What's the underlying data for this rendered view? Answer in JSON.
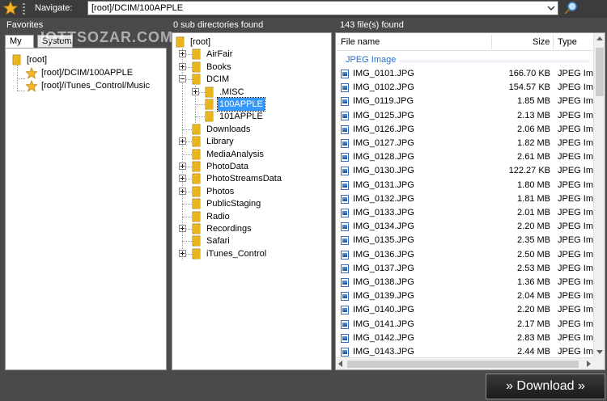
{
  "toolbar": {
    "navigate_label": "Navigate:",
    "path_value": "[root]/DCIM/100APPLE",
    "download_label": "» Download »"
  },
  "favorites": {
    "heading": "Favorites",
    "tabs": [
      "My",
      "System"
    ],
    "root_label": "[root]",
    "items": [
      "[root]/DCIM/100APPLE",
      "[root]/iTunes_Control/Music"
    ]
  },
  "directories": {
    "heading": "0 sub directories found",
    "root_label": "[root]",
    "items": [
      {
        "label": "AirFair",
        "level": 1,
        "expander": "plus"
      },
      {
        "label": "Books",
        "level": 1,
        "expander": "plus"
      },
      {
        "label": "DCIM",
        "level": 1,
        "expander": "minus"
      },
      {
        "label": ".MISC",
        "level": 2,
        "expander": "plus"
      },
      {
        "label": "100APPLE",
        "level": 2,
        "expander": "",
        "selected": true
      },
      {
        "label": "101APPLE",
        "level": 2,
        "expander": ""
      },
      {
        "label": "Downloads",
        "level": 1,
        "expander": ""
      },
      {
        "label": "Library",
        "level": 1,
        "expander": "plus"
      },
      {
        "label": "MediaAnalysis",
        "level": 1,
        "expander": ""
      },
      {
        "label": "PhotoData",
        "level": 1,
        "expander": "plus"
      },
      {
        "label": "PhotoStreamsData",
        "level": 1,
        "expander": "plus"
      },
      {
        "label": "Photos",
        "level": 1,
        "expander": "plus"
      },
      {
        "label": "PublicStaging",
        "level": 1,
        "expander": ""
      },
      {
        "label": "Radio",
        "level": 1,
        "expander": ""
      },
      {
        "label": "Recordings",
        "level": 1,
        "expander": "plus"
      },
      {
        "label": "Safari",
        "level": 1,
        "expander": ""
      },
      {
        "label": "iTunes_Control",
        "level": 1,
        "expander": "plus"
      }
    ]
  },
  "files": {
    "heading": "143 file(s) found",
    "columns": {
      "name": "File name",
      "size": "Size",
      "type": "Type"
    },
    "group": "JPEG Image",
    "rows": [
      {
        "name": "IMG_0101.JPG",
        "size": "166.70 KB",
        "type": "JPEG Ima"
      },
      {
        "name": "IMG_0102.JPG",
        "size": "154.57 KB",
        "type": "JPEG Ima"
      },
      {
        "name": "IMG_0119.JPG",
        "size": "1.85 MB",
        "type": "JPEG Ima"
      },
      {
        "name": "IMG_0125.JPG",
        "size": "2.13 MB",
        "type": "JPEG Ima"
      },
      {
        "name": "IMG_0126.JPG",
        "size": "2.06 MB",
        "type": "JPEG Ima"
      },
      {
        "name": "IMG_0127.JPG",
        "size": "1.82 MB",
        "type": "JPEG Ima"
      },
      {
        "name": "IMG_0128.JPG",
        "size": "2.61 MB",
        "type": "JPEG Ima"
      },
      {
        "name": "IMG_0130.JPG",
        "size": "122.27 KB",
        "type": "JPEG Ima"
      },
      {
        "name": "IMG_0131.JPG",
        "size": "1.80 MB",
        "type": "JPEG Ima"
      },
      {
        "name": "IMG_0132.JPG",
        "size": "1.81 MB",
        "type": "JPEG Ima"
      },
      {
        "name": "IMG_0133.JPG",
        "size": "2.01 MB",
        "type": "JPEG Ima"
      },
      {
        "name": "IMG_0134.JPG",
        "size": "2.20 MB",
        "type": "JPEG Ima"
      },
      {
        "name": "IMG_0135.JPG",
        "size": "2.35 MB",
        "type": "JPEG Ima"
      },
      {
        "name": "IMG_0136.JPG",
        "size": "2.50 MB",
        "type": "JPEG Ima"
      },
      {
        "name": "IMG_0137.JPG",
        "size": "2.53 MB",
        "type": "JPEG Ima"
      },
      {
        "name": "IMG_0138.JPG",
        "size": "1.36 MB",
        "type": "JPEG Ima"
      },
      {
        "name": "IMG_0139.JPG",
        "size": "2.04 MB",
        "type": "JPEG Ima"
      },
      {
        "name": "IMG_0140.JPG",
        "size": "2.20 MB",
        "type": "JPEG Ima"
      },
      {
        "name": "IMG_0141.JPG",
        "size": "2.17 MB",
        "type": "JPEG Ima"
      },
      {
        "name": "IMG_0142.JPG",
        "size": "2.83 MB",
        "type": "JPEG Ima"
      },
      {
        "name": "IMG_0143.JPG",
        "size": "2.44 MB",
        "type": "JPEG Ima"
      }
    ]
  },
  "watermark": "IOTTSOZAR.COM",
  "colors": {
    "selection": "#3399ff",
    "group_title": "#2a6ec6",
    "folder": "#e8b41c"
  }
}
